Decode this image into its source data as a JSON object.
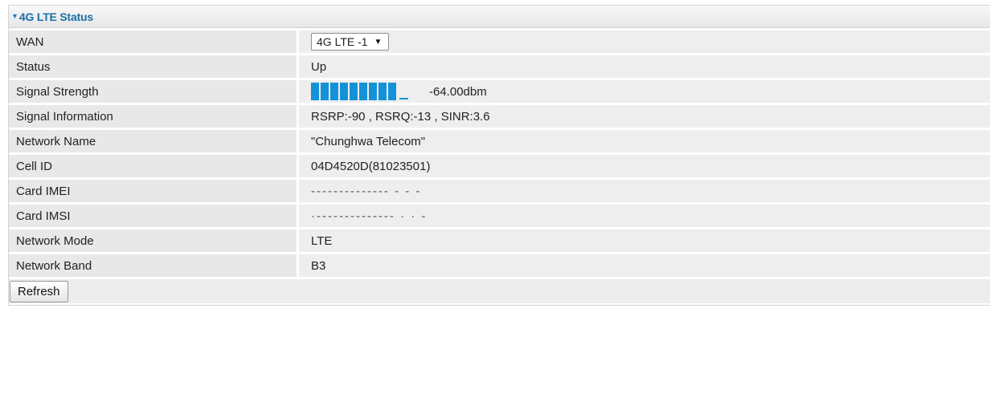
{
  "panel": {
    "title": "4G LTE Status",
    "collapse_icon": "triangle-down-icon"
  },
  "rows": [
    {
      "label": "WAN",
      "value": "4G LTE -1"
    },
    {
      "label": "Status",
      "value": "Up"
    },
    {
      "label": "Signal Strength",
      "value": "-64.00dbm"
    },
    {
      "label": "Signal Information",
      "value": "RSRP:-90 , RSRQ:-13 , SINR:3.6"
    },
    {
      "label": "Network Name",
      "value": "\"Chunghwa Telecom\""
    },
    {
      "label": "Cell ID",
      "value": "04D4520D(81023501)"
    },
    {
      "label": "Card IMEI",
      "value": "-------------- - - -"
    },
    {
      "label": "Card IMSI",
      "value": "·-------------- · · -"
    },
    {
      "label": "Network Mode",
      "value": "LTE"
    },
    {
      "label": "Network Band",
      "value": "B3"
    }
  ],
  "wan_select": {
    "selected": "4G LTE -1",
    "arrow_icon": "dropdown-arrow-icon"
  },
  "signal": {
    "level": 0.9,
    "filled_bars": 9,
    "total_bars": 10,
    "color": "#1392d8"
  },
  "actions": {
    "refresh_label": "Refresh"
  },
  "colors": {
    "title": "#1b6fa5",
    "label_bg": "#e8e8e8",
    "value_bg": "#eeeeee"
  }
}
